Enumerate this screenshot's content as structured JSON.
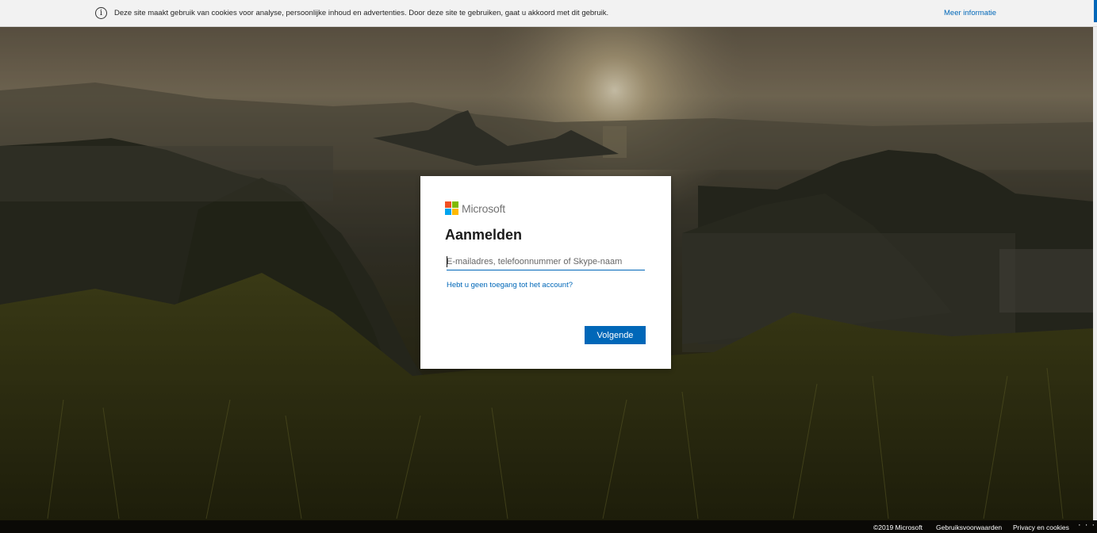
{
  "cookie_banner": {
    "icon": "info-icon",
    "text": "Deze site maakt gebruik van cookies voor analyse, persoonlijke inhoud en advertenties. Door deze site te gebruiken, gaat u akkoord met dit gebruik.",
    "link": "Meer informatie"
  },
  "signin": {
    "brand": "Microsoft",
    "title": "Aanmelden",
    "email_placeholder": "E-mailadres, telefoonnummer of Skype-naam",
    "email_value": "",
    "help_link": "Hebt u geen toegang tot het account?",
    "next_button": "Volgende"
  },
  "footer": {
    "copyright": "©2019 Microsoft",
    "terms": "Gebruiksvoorwaarden",
    "privacy": "Privacy en cookies",
    "more": "· · ·"
  },
  "colors": {
    "accent": "#0067b8",
    "logo_red": "#f25022",
    "logo_green": "#7fba00",
    "logo_blue": "#00a4ef",
    "logo_yellow": "#ffb900"
  }
}
